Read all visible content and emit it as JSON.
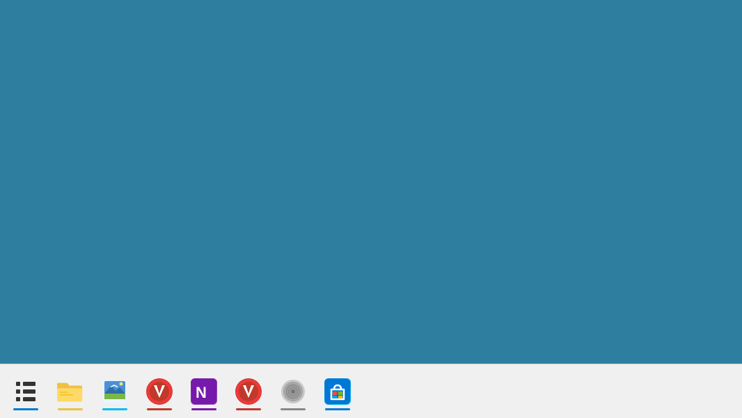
{
  "desktop": {
    "background_color": "#2e7f9f"
  },
  "taskbar": {
    "background_color": "#f0f0f0",
    "icons": [
      {
        "id": "ableton",
        "label": "Ableton Live",
        "type": "grid",
        "active_bar_color": "#0078d4"
      },
      {
        "id": "file-explorer",
        "label": "File Explorer",
        "type": "folder",
        "active_bar_color": "#f0c040"
      },
      {
        "id": "xnview",
        "label": "XnView",
        "type": "image-viewer",
        "active_bar_color": "#00bcf2"
      },
      {
        "id": "vivaldi",
        "label": "Vivaldi",
        "type": "vivaldi",
        "active_bar_color": "#c0392b"
      },
      {
        "id": "onenote",
        "label": "Microsoft OneNote",
        "type": "onenote",
        "active_bar_color": "#7719aa"
      },
      {
        "id": "vivaldi2",
        "label": "Vivaldi",
        "type": "vivaldi",
        "active_bar_color": "#c0392b"
      },
      {
        "id": "audio",
        "label": "Audio Control",
        "type": "audio",
        "active_bar_color": "#888"
      },
      {
        "id": "msstore",
        "label": "Microsoft Store",
        "type": "store",
        "active_bar_color": "#0078d4"
      }
    ]
  }
}
